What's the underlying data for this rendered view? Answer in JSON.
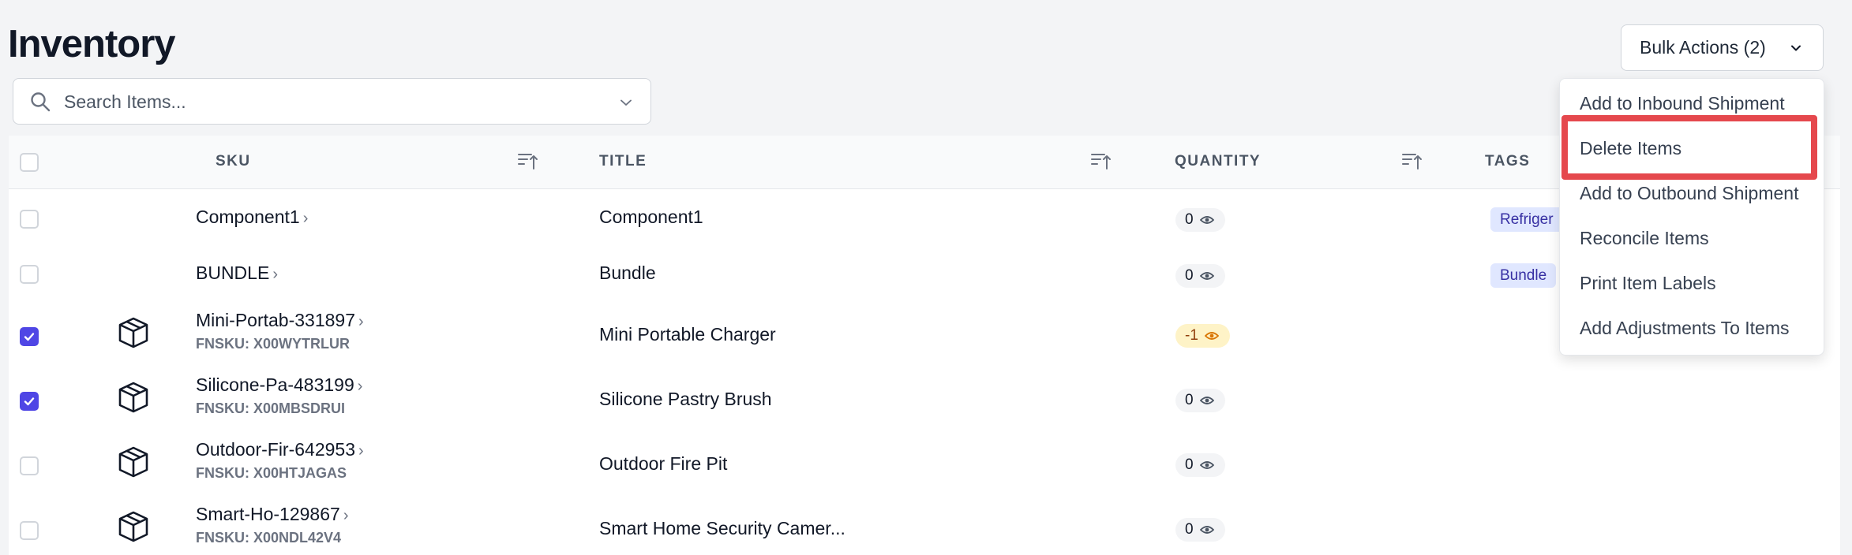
{
  "page": {
    "title": "Inventory"
  },
  "bulk_actions": {
    "label": "Bulk Actions (2)"
  },
  "search": {
    "placeholder": "Search Items..."
  },
  "table": {
    "columns": {
      "sku": "SKU",
      "title": "TITLE",
      "quantity": "QUANTITY",
      "tags": "TAGS"
    },
    "rows": [
      {
        "sku": "Component1",
        "fnsku": "",
        "title": "Component1",
        "quantity": "0",
        "tag": "Refriger",
        "checked": false,
        "has_icon": false
      },
      {
        "sku": "BUNDLE",
        "fnsku": "",
        "title": "Bundle",
        "quantity": "0",
        "tag": "Bundle",
        "checked": false,
        "has_icon": false
      },
      {
        "sku": "Mini-Portab-331897",
        "fnsku": "FNSKU: X00WYTRLUR",
        "title": "Mini Portable Charger",
        "quantity": "-1",
        "tag": "",
        "checked": true,
        "has_icon": true
      },
      {
        "sku": "Silicone-Pa-483199",
        "fnsku": "FNSKU: X00MBSDRUI",
        "title": "Silicone Pastry Brush",
        "quantity": "0",
        "tag": "",
        "checked": true,
        "has_icon": true
      },
      {
        "sku": "Outdoor-Fir-642953",
        "fnsku": "FNSKU: X00HTJAGAS",
        "title": "Outdoor Fire Pit",
        "quantity": "0",
        "tag": "",
        "checked": false,
        "has_icon": true
      },
      {
        "sku": "Smart-Ho-129867",
        "fnsku": "FNSKU: X00NDL42V4",
        "title": "Smart Home Security Camer...",
        "quantity": "0",
        "tag": "",
        "checked": false,
        "has_icon": true
      }
    ]
  },
  "dropdown": {
    "items": [
      "Add to Inbound Shipment",
      "Delete Items",
      "Add to Outbound Shipment",
      "Reconcile Items",
      "Print Item Labels",
      "Add Adjustments To Items"
    ],
    "highlighted_index": 1
  },
  "colors": {
    "accent": "#4f46e5",
    "highlight": "#e5484d",
    "tag_bg": "#e0e7ff",
    "warning_bg": "#fef3c7"
  },
  "icons": [
    "search-icon",
    "chevron-down-icon",
    "sort-icon",
    "box-icon",
    "eye-icon",
    "checkmark-icon"
  ]
}
